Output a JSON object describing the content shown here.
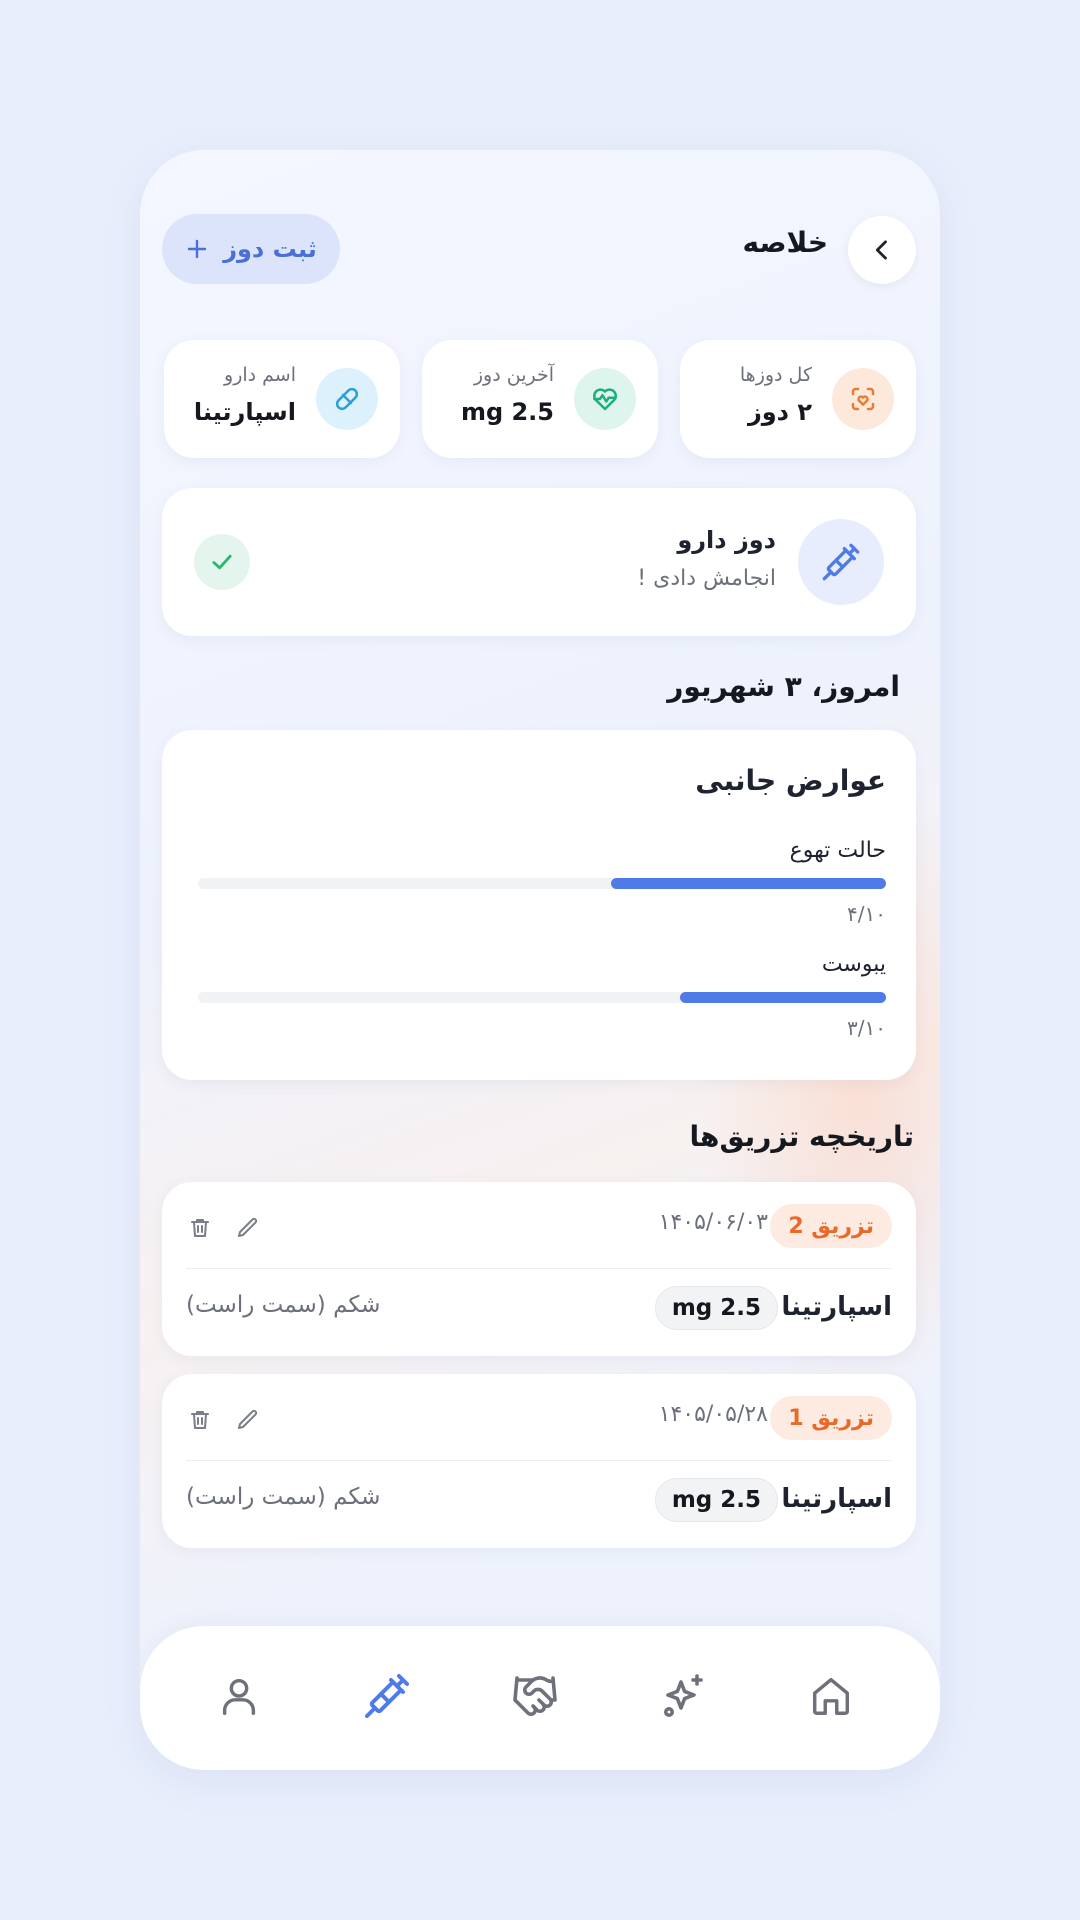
{
  "header": {
    "title": "خلاصه",
    "add_dose_label": "ثبت دوز"
  },
  "stats": [
    {
      "label": "کل دوزها",
      "value": "۲ دوز",
      "icon": "heart-scan-icon"
    },
    {
      "label": "آخرین دوز",
      "value": "mg 2.5",
      "icon": "heart-pulse-icon"
    },
    {
      "label": "اسم دارو",
      "value": "اسپارتینا",
      "icon": "pill-icon"
    }
  ],
  "dose_status": {
    "title": "دوز دارو",
    "subtitle": "انجامش دادی !",
    "icon": "syringe-icon"
  },
  "date_title": "امروز، ۳ شهریور",
  "side_effects": {
    "title": "عوارض جانبی",
    "items": [
      {
        "label": "حالت تهوع",
        "score": "۴/۱۰",
        "level": 0.4
      },
      {
        "label": "یبوست",
        "score": "۳/۱۰",
        "level": 0.3
      }
    ]
  },
  "history": {
    "title": "تاریخچه تزریق‌ها",
    "entries": [
      {
        "badge": "تزریق 2",
        "date": "۱۴۰۵/۰۶/۰۳",
        "drug": "اسپارتینا",
        "dose": "mg 2.5",
        "site": "شکم (سمت راست)"
      },
      {
        "badge": "تزریق 1",
        "date": "۱۴۰۵/۰۵/۲۸",
        "drug": "اسپارتینا",
        "dose": "mg 2.5",
        "site": "شکم (سمت راست)"
      }
    ]
  },
  "colors": {
    "accent": "#4f7be9",
    "badge_text": "#e8692a",
    "badge_bg": "#fdebe1",
    "success": "#2bb673"
  },
  "nav": [
    {
      "name": "profile",
      "icon": "user-icon",
      "active": false
    },
    {
      "name": "injections",
      "icon": "syringe-icon",
      "active": true
    },
    {
      "name": "support",
      "icon": "handshake-icon",
      "active": false
    },
    {
      "name": "ai",
      "icon": "sparkles-icon",
      "active": false
    },
    {
      "name": "home",
      "icon": "home-icon",
      "active": false
    }
  ]
}
